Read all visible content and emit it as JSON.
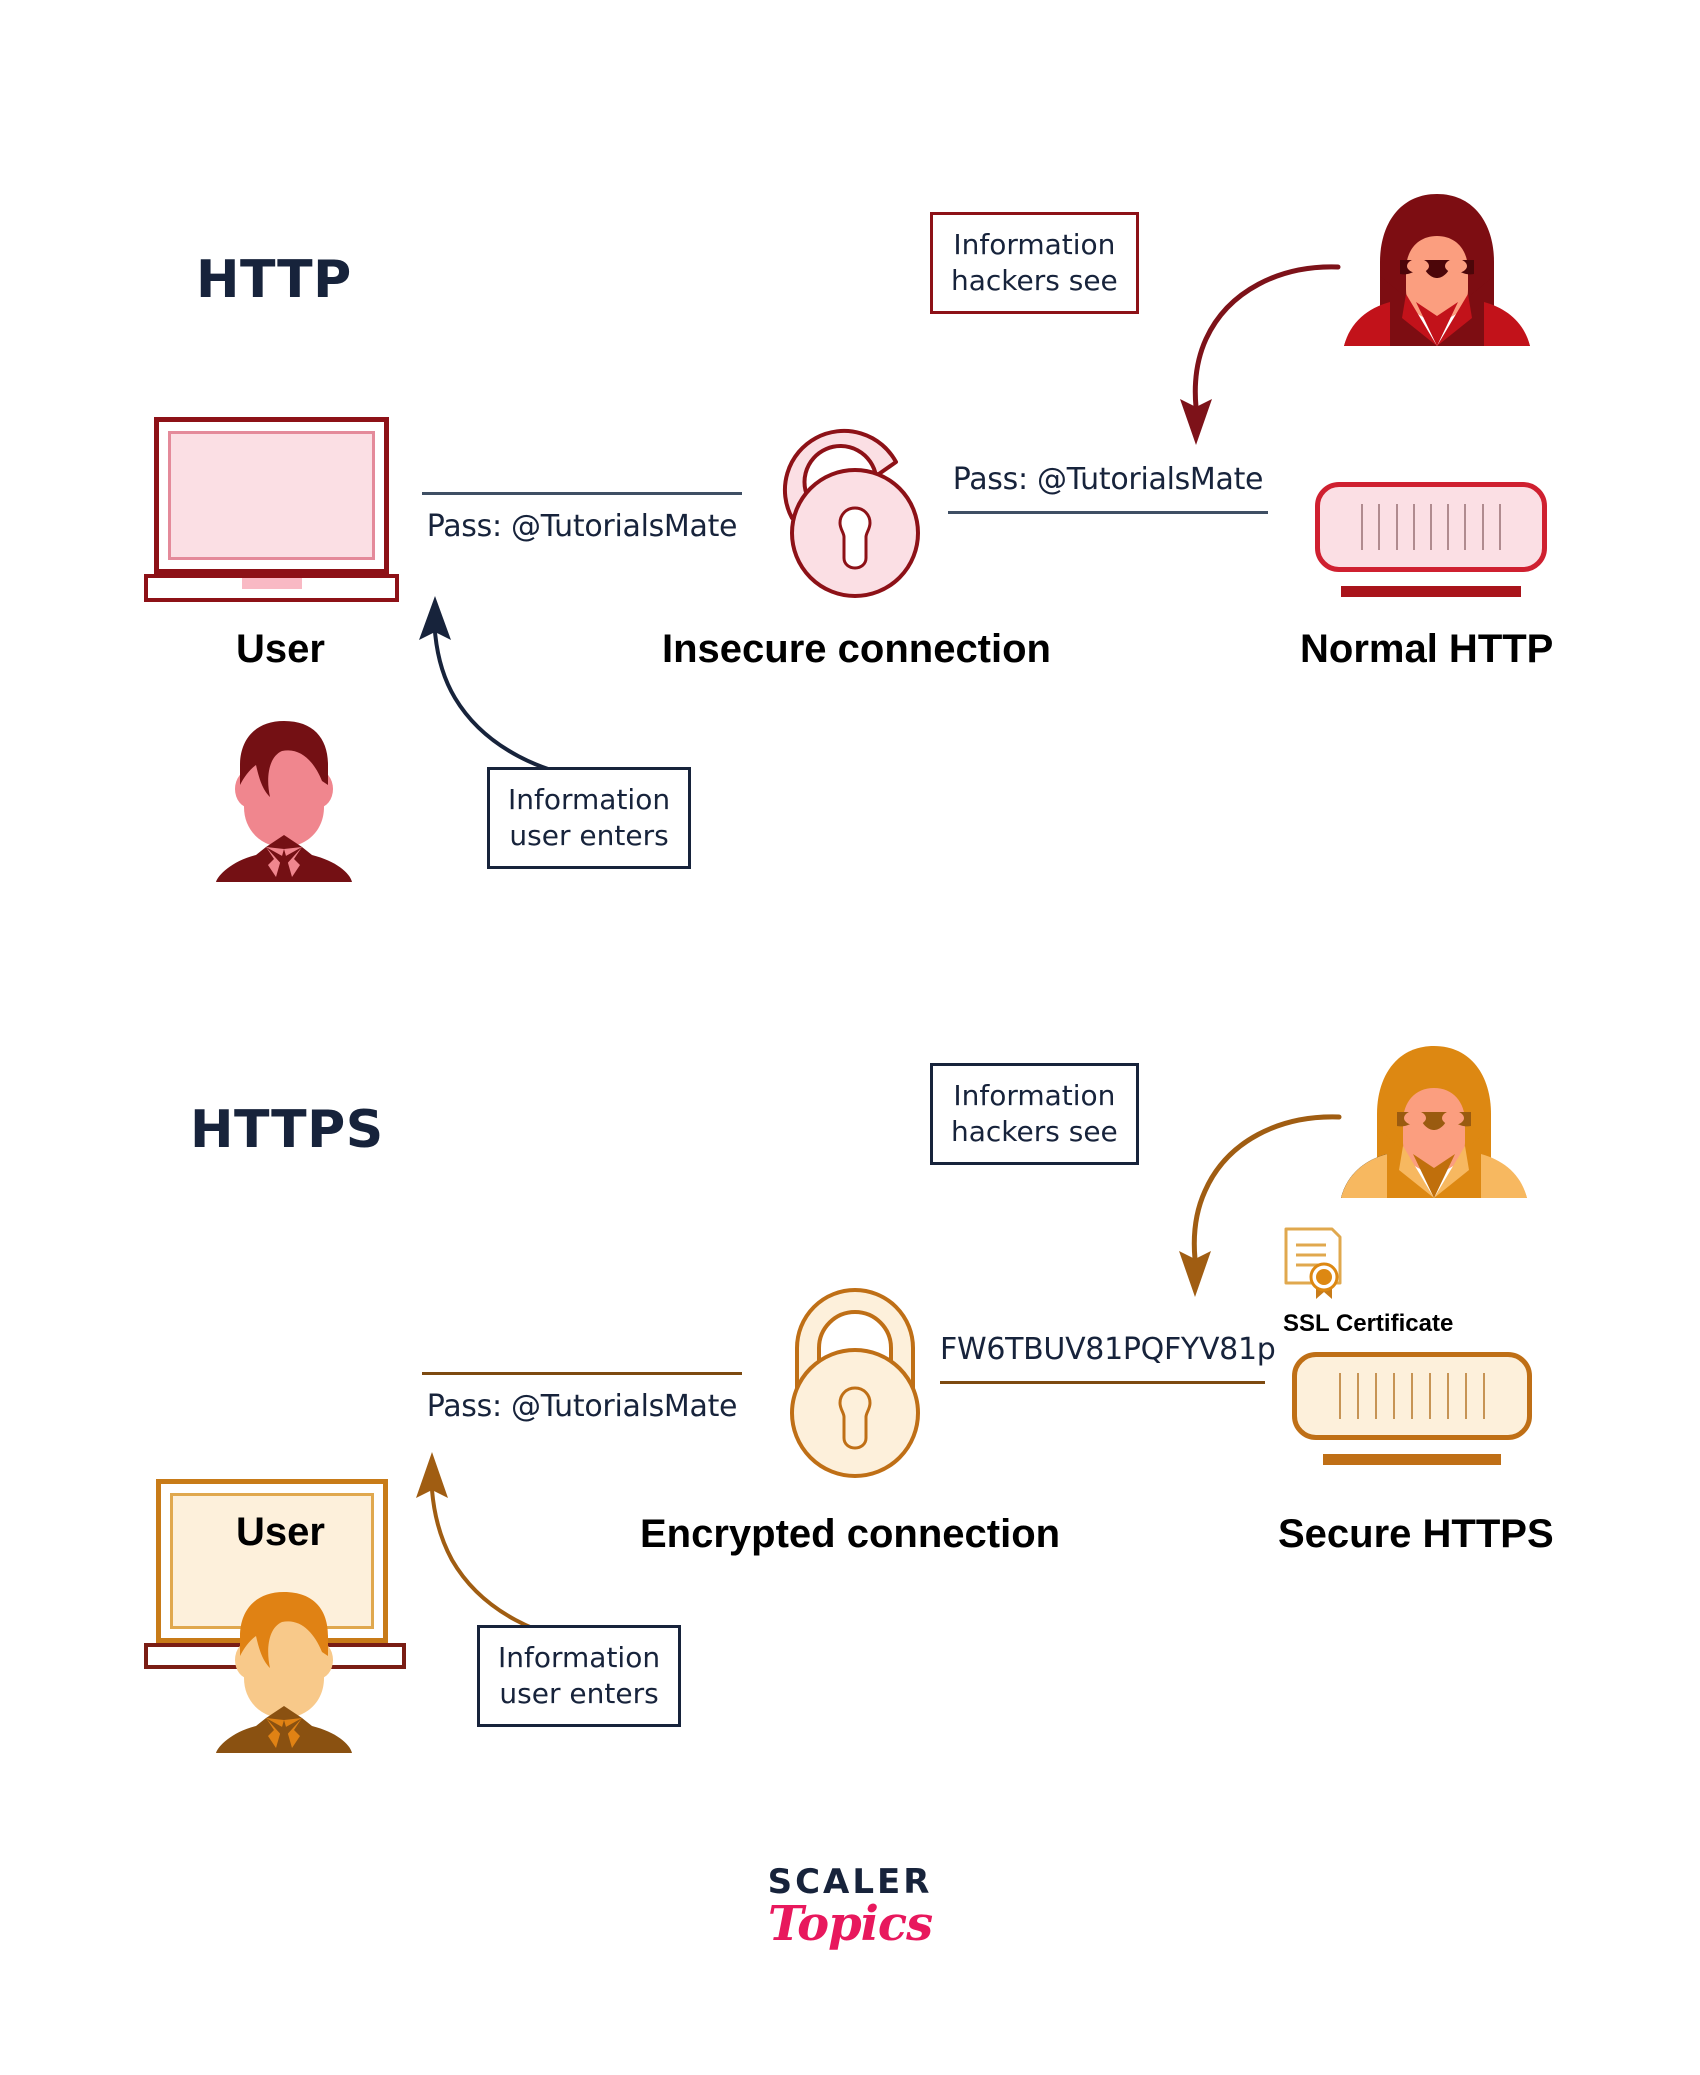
{
  "diagram": {
    "title_http": "HTTP",
    "title_https": "HTTPS",
    "sections": [
      {
        "id": "http",
        "protocol": "HTTP",
        "accent": "#8d1117",
        "accent_light": "#fbdfe4",
        "user_label": "User",
        "connection_label": "Insecure connection",
        "server_label": "Normal HTTP",
        "pass_left": "Pass: @TutorialsMate",
        "pass_right": "Pass: @TutorialsMate",
        "callout_user": "Information\nuser enters",
        "callout_user_line1": "Information",
        "callout_user_line2": "user enters",
        "callout_hacker_line1": "Information",
        "callout_hacker_line2": "hackers see",
        "lock_state": "unlocked",
        "hacker_color": "#a40e15",
        "has_ssl": false
      },
      {
        "id": "https",
        "protocol": "HTTPS",
        "accent": "#bf6f16",
        "accent_light": "#fdf0db",
        "user_label": "User",
        "connection_label": "Encrypted connection",
        "server_label": "Secure HTTPS",
        "pass_left": "Pass: @TutorialsMate",
        "pass_right": "FW6TBUV81PQFYV81p",
        "callout_user_line1": "Information",
        "callout_user_line2": "user enters",
        "callout_hacker_line1": "Information",
        "callout_hacker_line2": "hackers see",
        "lock_state": "locked",
        "hacker_color": "#dd8812",
        "has_ssl": true,
        "ssl_label": "SSL Certificate"
      }
    ]
  },
  "logo": {
    "brand": "SCALER",
    "product": "Topics",
    "brand_color": "#17233b",
    "product_color": "#e8185d"
  },
  "icons": {
    "laptop": "laptop-icon",
    "open_lock": "open-padlock-icon",
    "closed_lock": "closed-padlock-icon",
    "hacker": "hacker-icon",
    "user": "user-avatar-icon",
    "server": "server-icon",
    "certificate": "ssl-certificate-icon",
    "arrow": "curved-arrow-icon"
  }
}
